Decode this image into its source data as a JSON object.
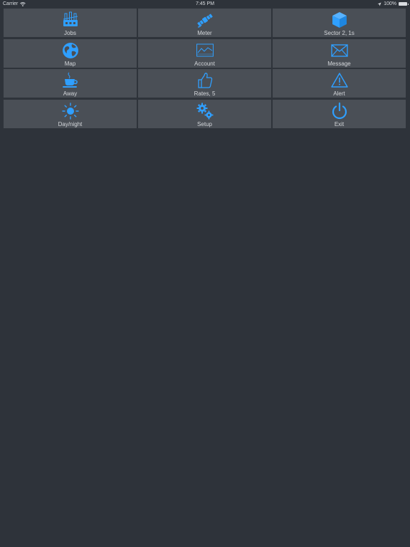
{
  "status_bar": {
    "carrier": "Carrier",
    "time": "7:45 PM",
    "battery": "100%",
    "battery_level": 1.0,
    "icons": [
      "wifi-icon",
      "location-arrow-icon",
      "battery-icon"
    ]
  },
  "accent_color": "#2f9fff",
  "tile_color": "#4a4f56",
  "background_color": "#2e333a",
  "tiles": [
    {
      "label": "Jobs",
      "icon": "jobs-icon"
    },
    {
      "label": "Meter",
      "icon": "satellite-icon"
    },
    {
      "label": "Sector 2, 1s",
      "icon": "cube-icon"
    },
    {
      "label": "Map",
      "icon": "globe-icon"
    },
    {
      "label": "Account",
      "icon": "chart-icon"
    },
    {
      "label": "Message",
      "icon": "envelope-icon"
    },
    {
      "label": "Away",
      "icon": "coffee-cup-icon"
    },
    {
      "label": "Rates, 5",
      "icon": "thumbs-up-icon"
    },
    {
      "label": "Alert",
      "icon": "warning-icon"
    },
    {
      "label": "Day/night",
      "icon": "sun-icon"
    },
    {
      "label": "Setup",
      "icon": "gears-icon"
    },
    {
      "label": "Exit",
      "icon": "power-icon"
    }
  ]
}
